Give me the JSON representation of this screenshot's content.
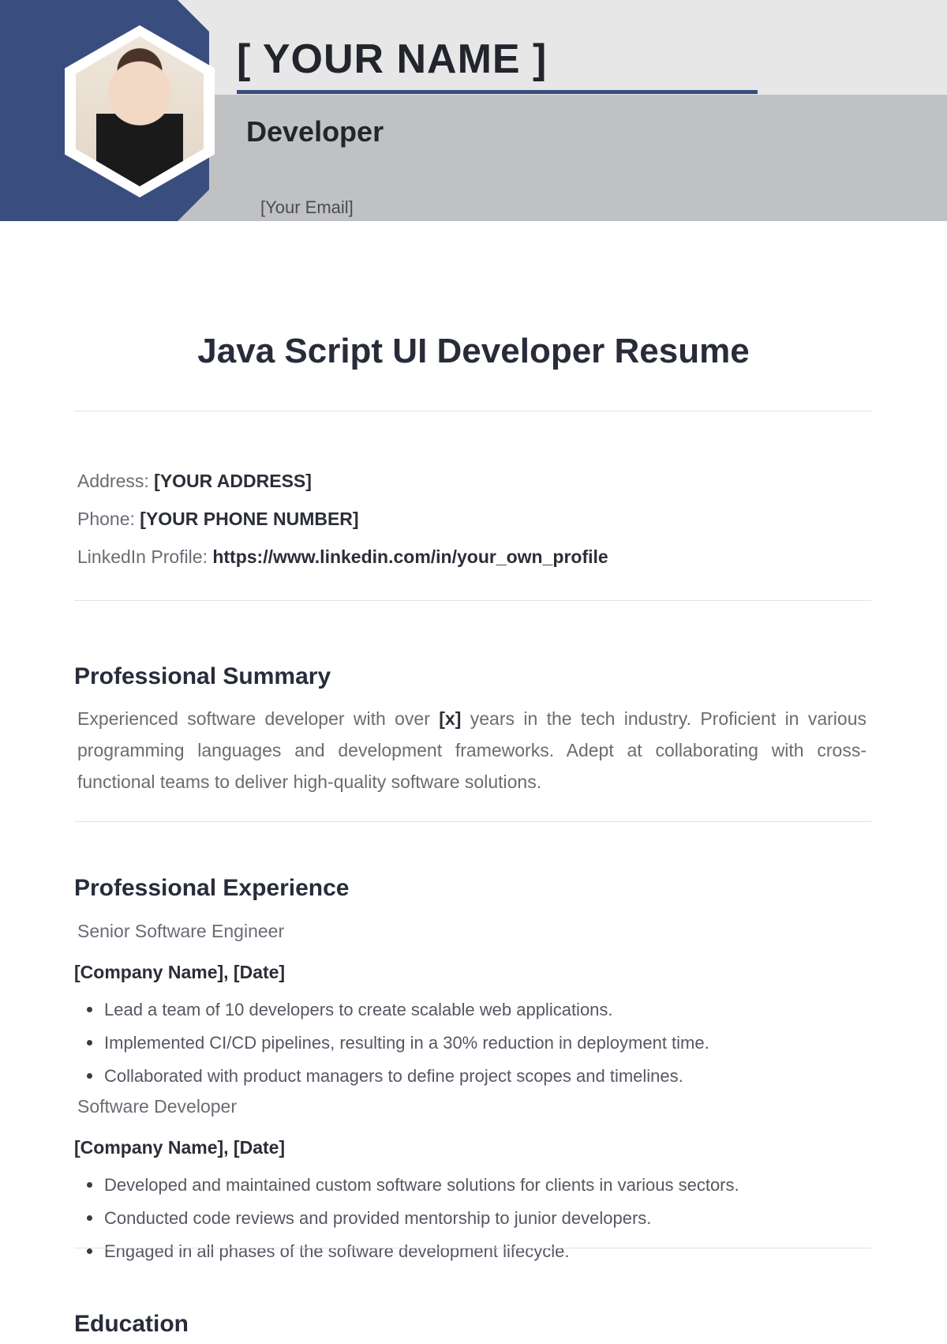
{
  "header": {
    "name_placeholder": "[ YOUR NAME ]",
    "subtitle": "Developer",
    "email_placeholder": "[Your Email]"
  },
  "title": "Java Script UI Developer Resume",
  "contact": {
    "address_label": "Address: ",
    "address_value": "[YOUR ADDRESS]",
    "phone_label": "Phone: ",
    "phone_value": "[YOUR PHONE NUMBER]",
    "linkedin_label": "LinkedIn Profile: ",
    "linkedin_value": "https://www.linkedin.com/in/your_own_profile"
  },
  "sections": {
    "summary": {
      "heading": "Professional Summary",
      "text_before": "Experienced software developer with over ",
      "years_placeholder": "[x]",
      "text_after": " years in the tech industry. Proficient in various programming languages and development frameworks. Adept at collaborating with cross-functional teams to deliver high-quality software solutions."
    },
    "experience": {
      "heading": "Professional Experience",
      "jobs": [
        {
          "role": "Senior Software Engineer",
          "meta": "[Company Name], [Date]",
          "bullets": [
            "Lead a team of 10 developers to create scalable web applications.",
            "Implemented CI/CD pipelines, resulting in a 30% reduction in deployment time.",
            "Collaborated with product managers to define project scopes and timelines."
          ]
        },
        {
          "role": "Software Developer",
          "meta": "[Company Name], [Date]",
          "bullets": [
            "Developed and maintained custom software solutions for clients in various sectors.",
            "Conducted code reviews and provided mentorship to junior developers.",
            "Engaged in all phases of the software development lifecycle."
          ]
        }
      ]
    },
    "education": {
      "heading": "Education"
    }
  }
}
